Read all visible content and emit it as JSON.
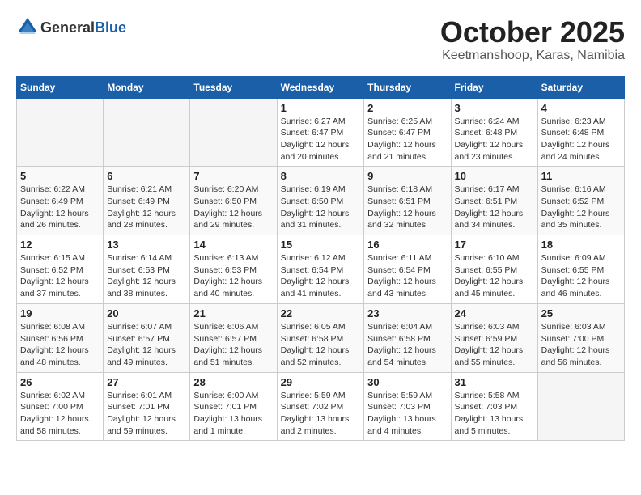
{
  "header": {
    "logo": {
      "general": "General",
      "blue": "Blue"
    },
    "title": "October 2025",
    "location": "Keetmanshoop, Karas, Namibia"
  },
  "weekdays": [
    "Sunday",
    "Monday",
    "Tuesday",
    "Wednesday",
    "Thursday",
    "Friday",
    "Saturday"
  ],
  "weeks": [
    [
      {
        "day": "",
        "sunrise": "",
        "sunset": "",
        "daylight": ""
      },
      {
        "day": "",
        "sunrise": "",
        "sunset": "",
        "daylight": ""
      },
      {
        "day": "",
        "sunrise": "",
        "sunset": "",
        "daylight": ""
      },
      {
        "day": "1",
        "sunrise": "Sunrise: 6:27 AM",
        "sunset": "Sunset: 6:47 PM",
        "daylight": "Daylight: 12 hours and 20 minutes."
      },
      {
        "day": "2",
        "sunrise": "Sunrise: 6:25 AM",
        "sunset": "Sunset: 6:47 PM",
        "daylight": "Daylight: 12 hours and 21 minutes."
      },
      {
        "day": "3",
        "sunrise": "Sunrise: 6:24 AM",
        "sunset": "Sunset: 6:48 PM",
        "daylight": "Daylight: 12 hours and 23 minutes."
      },
      {
        "day": "4",
        "sunrise": "Sunrise: 6:23 AM",
        "sunset": "Sunset: 6:48 PM",
        "daylight": "Daylight: 12 hours and 24 minutes."
      }
    ],
    [
      {
        "day": "5",
        "sunrise": "Sunrise: 6:22 AM",
        "sunset": "Sunset: 6:49 PM",
        "daylight": "Daylight: 12 hours and 26 minutes."
      },
      {
        "day": "6",
        "sunrise": "Sunrise: 6:21 AM",
        "sunset": "Sunset: 6:49 PM",
        "daylight": "Daylight: 12 hours and 28 minutes."
      },
      {
        "day": "7",
        "sunrise": "Sunrise: 6:20 AM",
        "sunset": "Sunset: 6:50 PM",
        "daylight": "Daylight: 12 hours and 29 minutes."
      },
      {
        "day": "8",
        "sunrise": "Sunrise: 6:19 AM",
        "sunset": "Sunset: 6:50 PM",
        "daylight": "Daylight: 12 hours and 31 minutes."
      },
      {
        "day": "9",
        "sunrise": "Sunrise: 6:18 AM",
        "sunset": "Sunset: 6:51 PM",
        "daylight": "Daylight: 12 hours and 32 minutes."
      },
      {
        "day": "10",
        "sunrise": "Sunrise: 6:17 AM",
        "sunset": "Sunset: 6:51 PM",
        "daylight": "Daylight: 12 hours and 34 minutes."
      },
      {
        "day": "11",
        "sunrise": "Sunrise: 6:16 AM",
        "sunset": "Sunset: 6:52 PM",
        "daylight": "Daylight: 12 hours and 35 minutes."
      }
    ],
    [
      {
        "day": "12",
        "sunrise": "Sunrise: 6:15 AM",
        "sunset": "Sunset: 6:52 PM",
        "daylight": "Daylight: 12 hours and 37 minutes."
      },
      {
        "day": "13",
        "sunrise": "Sunrise: 6:14 AM",
        "sunset": "Sunset: 6:53 PM",
        "daylight": "Daylight: 12 hours and 38 minutes."
      },
      {
        "day": "14",
        "sunrise": "Sunrise: 6:13 AM",
        "sunset": "Sunset: 6:53 PM",
        "daylight": "Daylight: 12 hours and 40 minutes."
      },
      {
        "day": "15",
        "sunrise": "Sunrise: 6:12 AM",
        "sunset": "Sunset: 6:54 PM",
        "daylight": "Daylight: 12 hours and 41 minutes."
      },
      {
        "day": "16",
        "sunrise": "Sunrise: 6:11 AM",
        "sunset": "Sunset: 6:54 PM",
        "daylight": "Daylight: 12 hours and 43 minutes."
      },
      {
        "day": "17",
        "sunrise": "Sunrise: 6:10 AM",
        "sunset": "Sunset: 6:55 PM",
        "daylight": "Daylight: 12 hours and 45 minutes."
      },
      {
        "day": "18",
        "sunrise": "Sunrise: 6:09 AM",
        "sunset": "Sunset: 6:55 PM",
        "daylight": "Daylight: 12 hours and 46 minutes."
      }
    ],
    [
      {
        "day": "19",
        "sunrise": "Sunrise: 6:08 AM",
        "sunset": "Sunset: 6:56 PM",
        "daylight": "Daylight: 12 hours and 48 minutes."
      },
      {
        "day": "20",
        "sunrise": "Sunrise: 6:07 AM",
        "sunset": "Sunset: 6:57 PM",
        "daylight": "Daylight: 12 hours and 49 minutes."
      },
      {
        "day": "21",
        "sunrise": "Sunrise: 6:06 AM",
        "sunset": "Sunset: 6:57 PM",
        "daylight": "Daylight: 12 hours and 51 minutes."
      },
      {
        "day": "22",
        "sunrise": "Sunrise: 6:05 AM",
        "sunset": "Sunset: 6:58 PM",
        "daylight": "Daylight: 12 hours and 52 minutes."
      },
      {
        "day": "23",
        "sunrise": "Sunrise: 6:04 AM",
        "sunset": "Sunset: 6:58 PM",
        "daylight": "Daylight: 12 hours and 54 minutes."
      },
      {
        "day": "24",
        "sunrise": "Sunrise: 6:03 AM",
        "sunset": "Sunset: 6:59 PM",
        "daylight": "Daylight: 12 hours and 55 minutes."
      },
      {
        "day": "25",
        "sunrise": "Sunrise: 6:03 AM",
        "sunset": "Sunset: 7:00 PM",
        "daylight": "Daylight: 12 hours and 56 minutes."
      }
    ],
    [
      {
        "day": "26",
        "sunrise": "Sunrise: 6:02 AM",
        "sunset": "Sunset: 7:00 PM",
        "daylight": "Daylight: 12 hours and 58 minutes."
      },
      {
        "day": "27",
        "sunrise": "Sunrise: 6:01 AM",
        "sunset": "Sunset: 7:01 PM",
        "daylight": "Daylight: 12 hours and 59 minutes."
      },
      {
        "day": "28",
        "sunrise": "Sunrise: 6:00 AM",
        "sunset": "Sunset: 7:01 PM",
        "daylight": "Daylight: 13 hours and 1 minute."
      },
      {
        "day": "29",
        "sunrise": "Sunrise: 5:59 AM",
        "sunset": "Sunset: 7:02 PM",
        "daylight": "Daylight: 13 hours and 2 minutes."
      },
      {
        "day": "30",
        "sunrise": "Sunrise: 5:59 AM",
        "sunset": "Sunset: 7:03 PM",
        "daylight": "Daylight: 13 hours and 4 minutes."
      },
      {
        "day": "31",
        "sunrise": "Sunrise: 5:58 AM",
        "sunset": "Sunset: 7:03 PM",
        "daylight": "Daylight: 13 hours and 5 minutes."
      },
      {
        "day": "",
        "sunrise": "",
        "sunset": "",
        "daylight": ""
      }
    ]
  ]
}
